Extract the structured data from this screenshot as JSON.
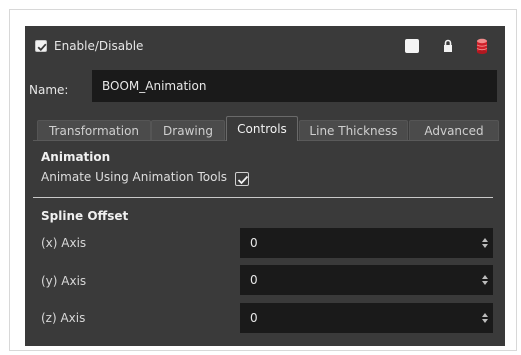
{
  "header": {
    "enable_label": "Enable/Disable",
    "enable_checked": true
  },
  "name_row": {
    "label": "Name:",
    "value": "BOOM_Animation"
  },
  "tabs": [
    {
      "label": "Transformation",
      "active": false
    },
    {
      "label": "Drawing",
      "active": false
    },
    {
      "label": "Controls",
      "active": true
    },
    {
      "label": "Line Thickness",
      "active": false
    },
    {
      "label": "Advanced",
      "active": false
    }
  ],
  "animation": {
    "title": "Animation",
    "option_label": "Animate Using Animation Tools",
    "option_checked": true
  },
  "spline_offset": {
    "title": "Spline Offset",
    "axes": [
      {
        "label": "(x) Axis",
        "value": "0"
      },
      {
        "label": "(y) Axis",
        "value": "0"
      },
      {
        "label": "(z) Axis",
        "value": "0"
      }
    ]
  },
  "icons": {
    "color_swatch": "white-square-icon",
    "lock": "lock-icon",
    "database": "red-database-icon"
  },
  "colors": {
    "panel_bg": "#3a3a3a",
    "field_bg": "#1a1a1a",
    "accent_red": "#d0202a"
  }
}
